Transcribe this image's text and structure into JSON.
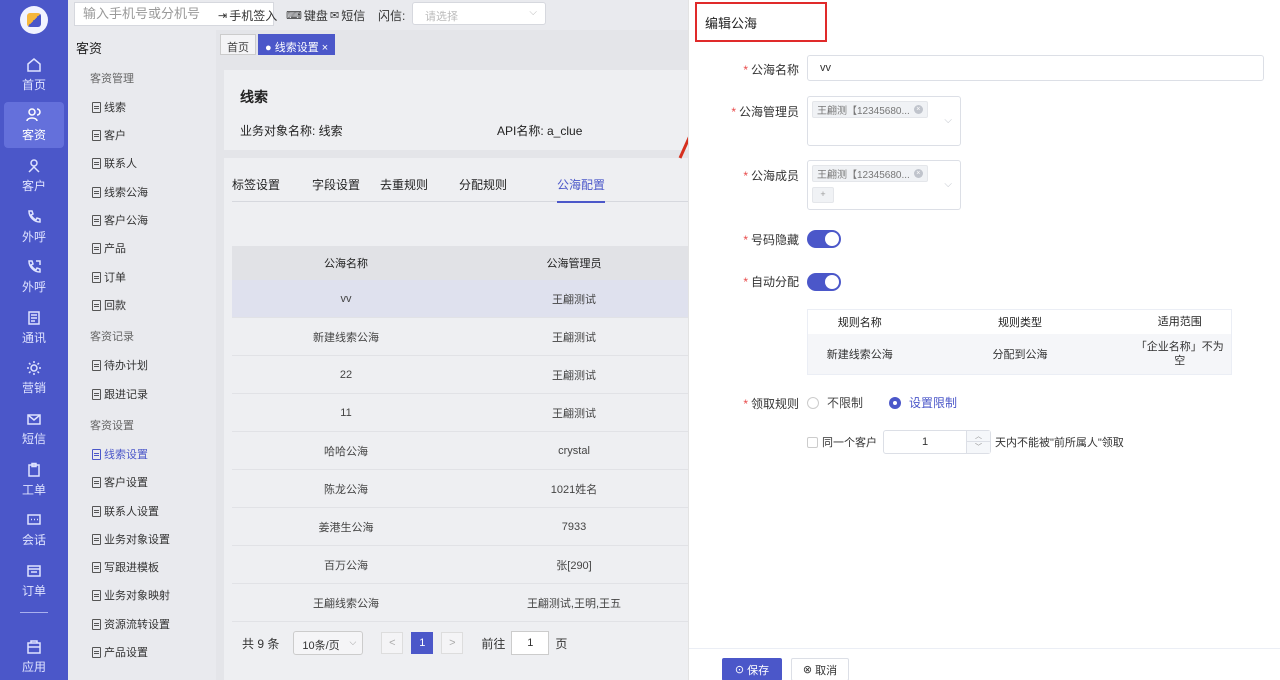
{
  "rail": {
    "items": [
      {
        "label": "首页",
        "icon": "home-icon"
      },
      {
        "label": "客资",
        "icon": "users-icon"
      },
      {
        "label": "客户",
        "icon": "user-icon"
      },
      {
        "label": "外呼",
        "icon": "phone-icon"
      },
      {
        "label": "外呼",
        "icon": "phone-out-icon"
      },
      {
        "label": "通讯",
        "icon": "contacts-icon"
      },
      {
        "label": "营销",
        "icon": "gear-icon"
      },
      {
        "label": "短信",
        "icon": "sms-icon"
      },
      {
        "label": "工单",
        "icon": "clipboard-icon"
      },
      {
        "label": "会话",
        "icon": "chat-icon"
      },
      {
        "label": "订单",
        "icon": "order-icon"
      },
      {
        "label": "应用",
        "icon": "apps-icon"
      }
    ]
  },
  "topbar": {
    "search_placeholder": "输入手机号或分机号",
    "checkin": "手机签入",
    "keyboard": "键盘",
    "sms": "短信",
    "flash_label": "闪信:",
    "flash_placeholder": "请选择"
  },
  "sidenav": {
    "title": "客资",
    "groups": {
      "g1": "客资管理",
      "g2": "客资记录",
      "g3": "客资设置"
    },
    "items": {
      "xiansuo": "线索",
      "kehu": "客户",
      "lianxiren": "联系人",
      "xiansuogonghai": "线索公海",
      "kehugonghai": "客户公海",
      "chanpin": "产品",
      "dingdan": "订单",
      "huikuan": "回款",
      "daiban": "待办计划",
      "genjin": "跟进记录",
      "xiansuoshezhi": "线索设置",
      "kehushezhi": "客户设置",
      "lianxirenshezhi": "联系人设置",
      "yewuduixiang": "业务对象设置",
      "xiegenjin": "写跟进模板",
      "yingshe": "业务对象映射",
      "liuzhuan": "资源流转设置",
      "chanpinshezhi": "产品设置"
    }
  },
  "main": {
    "tags": [
      "首页",
      "线索设置"
    ],
    "title": "线索",
    "object_name": "业务对象名称: 线索",
    "api_name": "API名称: a_clue",
    "tabs": [
      "标签设置",
      "字段设置",
      "去重规则",
      "分配规则",
      "公海配置"
    ],
    "table": {
      "headers": [
        "公海名称",
        "公海管理员"
      ],
      "rows": [
        [
          "vv",
          "王翩测试"
        ],
        [
          "新建线索公海",
          "王翩测试"
        ],
        [
          "22",
          "王翩测试"
        ],
        [
          "11",
          "王翩测试"
        ],
        [
          "哈哈公海",
          "crystal"
        ],
        [
          "陈龙公海",
          "1021姓名"
        ],
        [
          "姜港生公海",
          "7933"
        ],
        [
          "百万公海",
          "张[290]"
        ],
        [
          "王翩线索公海",
          "王翩测试,王明,王五"
        ]
      ]
    },
    "pager": {
      "total": "共 9 条",
      "page_size": "10条/页",
      "prev": "<",
      "current": "1",
      "next": ">",
      "goto_label": "前往",
      "goto_value": "1",
      "page_unit": "页"
    }
  },
  "panel": {
    "title": "编辑公海",
    "fields": {
      "name_label": "公海名称",
      "name_value": "vv",
      "admin_label": "公海管理员",
      "admin_chip": "王翩测【12345680...",
      "member_label": "公海成员",
      "member_chip": "王翩测【12345680...",
      "member_more": "+",
      "hide_label": "号码隐藏",
      "hide_on": true,
      "auto_label": "自动分配",
      "auto_on": true,
      "claim_label": "领取规则"
    },
    "rules_table": {
      "headers": [
        "规则名称",
        "规则类型",
        "适用范围"
      ],
      "row": [
        "新建线索公海",
        "分配到公海",
        "「企业名称」不为空"
      ]
    },
    "claim": {
      "opt1": "不限制",
      "opt2": "设置限制",
      "selected": "设置限制"
    },
    "limit": {
      "prefix": "同一个客户",
      "value": "1",
      "suffix": "天内不能被\"前所属人\"领取"
    },
    "footer": {
      "save": "保存",
      "cancel": "取消"
    }
  },
  "colors": {
    "primary": "#4b57c9",
    "highlight_box": "#e02a2a",
    "required": "#e84b4b"
  }
}
